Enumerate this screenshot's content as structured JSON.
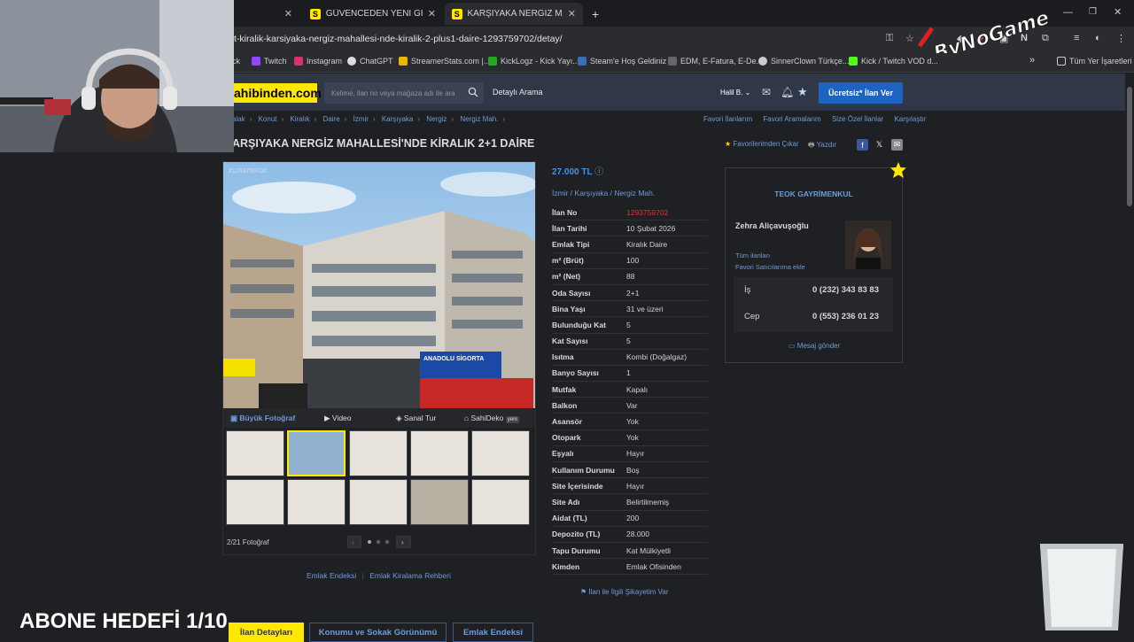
{
  "browser": {
    "tabs": [
      {
        "label": "GÜVENCEDEN YENİ GİRNE MEI"
      },
      {
        "label": "KARŞIYAKA NERGİZ MAHALLES"
      }
    ],
    "new_tab": "+",
    "url": "t-kiralik-karsiyaka-nergiz-mahallesi-nde-kiralik-2-plus1-daire-1293759702/detay/",
    "bookmarks": [
      "ck",
      "Twitch",
      "Instagram",
      "ChatGPT",
      "StreamerStats.com |...",
      "KickLogz - Kick Yayı...",
      "Steam'e Hoş Geldiniz",
      "EDM, E-Fatura, E-De...",
      "SinnerClown Türkçe...",
      "Kick / Twitch VOD d..."
    ],
    "bookmarks_more": "»",
    "all_bookmarks": "Tüm Yer İşaretleri"
  },
  "site": {
    "logo": "ahibinden.com",
    "search_placeholder": "Kelime, ilan no veya mağaza adı ile ara",
    "advanced_search": "Detaylı Arama",
    "user": "Halil B.",
    "post_ad": "Ücretsiz* İlan Ver"
  },
  "breadcrumb": [
    "alak",
    "Konut",
    "Kiralık",
    "Daire",
    "İzmir",
    "Karşıyaka",
    "Nergiz",
    "Nergiz Mah."
  ],
  "top_links": [
    "Favori İlanlarım",
    "Favori Aramalarım",
    "Size Özel İlanlar",
    "Karşılaştır"
  ],
  "title": "ARŞIYAKA NERGİZ MAHALLESİ'NDE KİRALIK 2+1 DAİRE",
  "actions": {
    "fav_remove": "Favorilerimden Çıkar",
    "print": "Yazdır"
  },
  "gallery": {
    "photo_id": "#1293759702",
    "media": [
      "Büyük Fotoğraf",
      "Video",
      "Sanal Tur",
      "SahiDeko"
    ],
    "new_badge": "yeni",
    "count": "2/21 Fotoğraf",
    "sign_text": "ANADOLU SİGORTA"
  },
  "listing": {
    "price": "27.000 TL",
    "location": [
      "İzmir",
      "Karşıyaka",
      "Nergiz Mah."
    ],
    "details": [
      {
        "k": "İlan No",
        "v": "1293759702",
        "red": true
      },
      {
        "k": "İlan Tarihi",
        "v": "10 Şubat 2026"
      },
      {
        "k": "Emlak Tipi",
        "v": "Kiralık Daire"
      },
      {
        "k": "m² (Brüt)",
        "v": "100"
      },
      {
        "k": "m² (Net)",
        "v": "88"
      },
      {
        "k": "Oda Sayısı",
        "v": "2+1"
      },
      {
        "k": "Bina Yaşı",
        "v": "31 ve üzeri"
      },
      {
        "k": "Bulunduğu Kat",
        "v": "5"
      },
      {
        "k": "Kat Sayısı",
        "v": "5"
      },
      {
        "k": "Isıtma",
        "v": "Kombi (Doğalgaz)"
      },
      {
        "k": "Banyo Sayısı",
        "v": "1"
      },
      {
        "k": "Mutfak",
        "v": "Kapalı"
      },
      {
        "k": "Balkon",
        "v": "Var"
      },
      {
        "k": "Asansör",
        "v": "Yok"
      },
      {
        "k": "Otopark",
        "v": "Yok"
      },
      {
        "k": "Eşyalı",
        "v": "Hayır"
      },
      {
        "k": "Kullanım Durumu",
        "v": "Boş"
      },
      {
        "k": "Site İçerisinde",
        "v": "Hayır"
      },
      {
        "k": "Site Adı",
        "v": "Belirtilmemiş"
      },
      {
        "k": "Aidat (TL)",
        "v": "200"
      },
      {
        "k": "Depozito (TL)",
        "v": "28.000"
      },
      {
        "k": "Tapu Durumu",
        "v": "Kat Mülkiyetli"
      },
      {
        "k": "Kimden",
        "v": "Emlak Ofisinden"
      }
    ],
    "complaint": "İlan ile İlgili Şikayetim Var"
  },
  "agency": {
    "name": "TEOK GAYRİMENKUL",
    "agent": "Zehra Aliçavuşoğlu",
    "all_ads": "Tüm ilanları",
    "fav_seller": "Favori Satıcılarıma ekle",
    "phone_work_label": "İş",
    "phone_work": "0 (232) 343 83 83",
    "phone_mobile_label": "Cep",
    "phone_mobile": "0 (553) 236 01 23",
    "send_message": "Mesaj gönder"
  },
  "bottom": {
    "links": [
      "Emlak Endeksi",
      "Emlak Kiralama Rehberi"
    ],
    "tabs": [
      "İlan Detayları",
      "Konumu ve Sokak Görünümü",
      "Emlak Endeksi"
    ]
  },
  "overlay": {
    "sub_goal": "ABONE HEDEFİ 1/10",
    "watermark": "ByNoGame"
  },
  "colors": {
    "accent": "#ffe800",
    "link": "#6f9bd6",
    "price": "#4a90e2",
    "button": "#1d64c2",
    "ad_no": "#e0303a"
  }
}
